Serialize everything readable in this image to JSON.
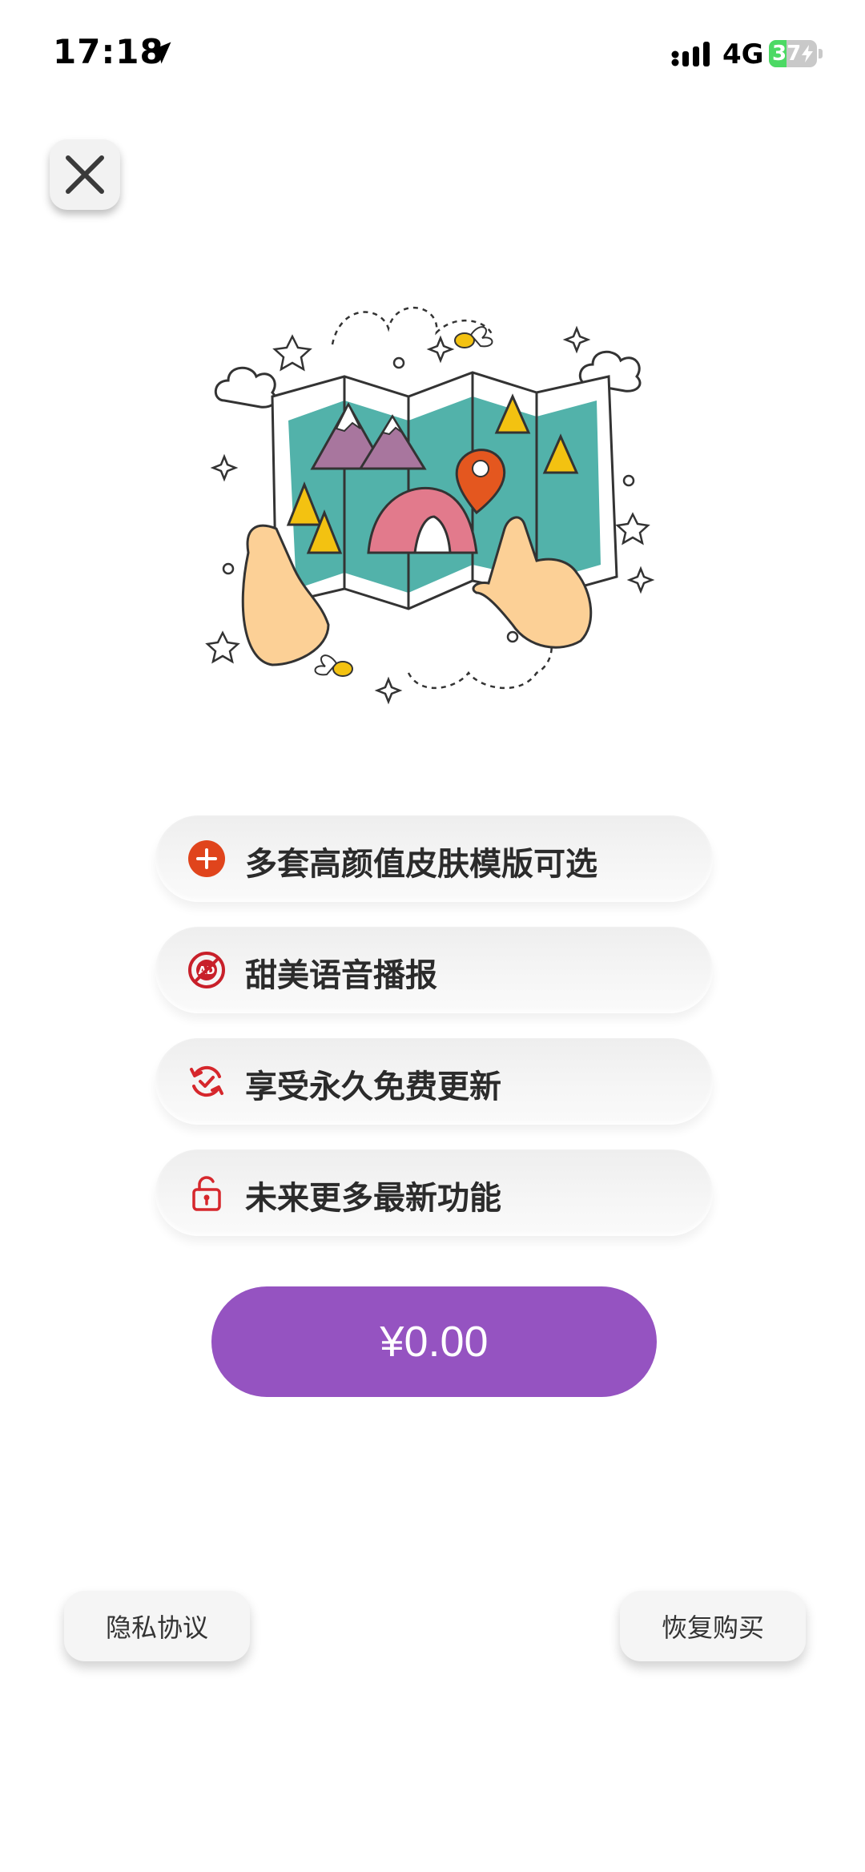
{
  "status_bar": {
    "time": "17:18",
    "network": "4G",
    "battery_level": "37",
    "battery_fraction": 0.37,
    "icons": [
      "location-arrow-icon",
      "signal-icon",
      "battery-icon",
      "charging-bolt-icon"
    ]
  },
  "close_button": {
    "icon": "close-icon"
  },
  "illustration": {
    "subject": "hands-holding-map-icon"
  },
  "features": [
    {
      "label": "多套高颜值皮肤模版可选",
      "icon": "plus-circle-icon",
      "color": "#e0441c"
    },
    {
      "label": "甜美语音播报",
      "icon": "no-ads-icon",
      "color": "#c8202a"
    },
    {
      "label": "享受永久免费更新",
      "icon": "refresh-check-icon",
      "color": "#d6272c"
    },
    {
      "label": "未来更多最新功能",
      "icon": "unlock-icon",
      "color": "#d6272c"
    }
  ],
  "purchase": {
    "price_label": "¥0.00",
    "color": "#9553c1"
  },
  "footer": {
    "privacy_label": "隐私协议",
    "restore_label": "恢复购买"
  }
}
